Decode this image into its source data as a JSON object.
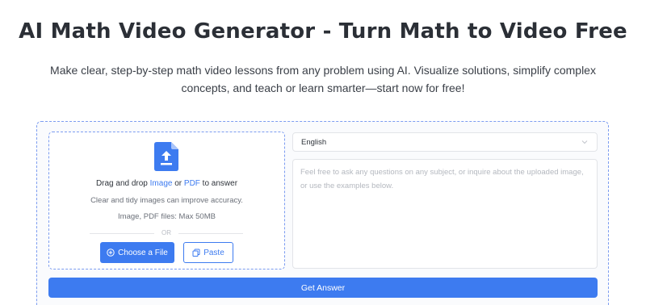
{
  "page": {
    "title": "AI Math Video Generator - Turn Math to Video Free",
    "subtitle": "Make clear, step-by-step math video lessons from any problem using AI. Visualize solutions, simplify complex concepts, and teach or learn smarter—start now for free!"
  },
  "upload": {
    "drag_prefix": "Drag and drop ",
    "image_link": "Image",
    "or_word": " or ",
    "pdf_link": "PDF",
    "drag_suffix": " to answer",
    "hint_accuracy": "Clear and tidy images can improve accuracy.",
    "hint_limit": "Image, PDF files: Max 50MB",
    "divider": "OR",
    "choose_label": "Choose a File",
    "paste_label": "Paste",
    "file_icon": "upload-file-icon"
  },
  "form": {
    "language_value": "English",
    "question_placeholder": "Feel free to ask any questions on any subject, or inquire about the uploaded image, or use the examples below.",
    "submit_label": "Get Answer"
  },
  "colors": {
    "accent": "#3d7bf0",
    "panel_border": "#7c9cf0",
    "title": "#2b2f36"
  }
}
